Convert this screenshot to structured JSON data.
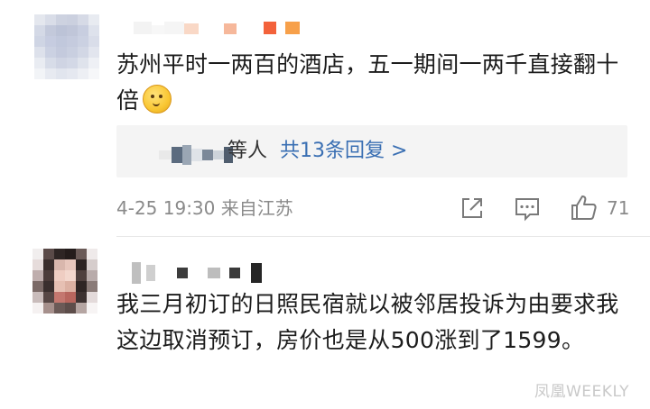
{
  "comments": [
    {
      "text": "苏州平时一两百的酒店，五一期间一两千直接翻十倍",
      "emoji": "thinking-face-icon",
      "replies": {
        "others_label": "等人",
        "link": "共13条回复 >"
      },
      "meta": {
        "time_location": "4-25 19:30 来自江苏",
        "like_count": "71"
      }
    },
    {
      "text": "我三月初订的日照民宿就以被邻居投诉为由要求我这边取消预订，房价也是从500涨到了1599。"
    }
  ],
  "watermark": "凤凰WEEKLY",
  "colors": {
    "link": "#3a6fb3",
    "meta": "#8a8a8a",
    "reply_bg": "#f4f4f4"
  }
}
